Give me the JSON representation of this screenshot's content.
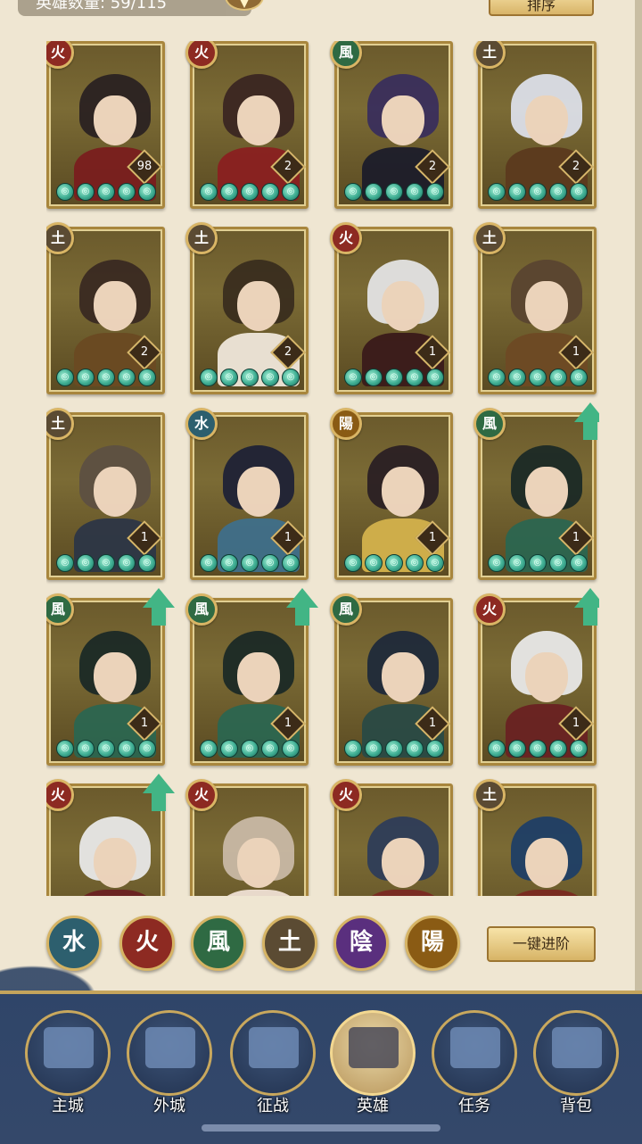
{
  "header": {
    "hero_count": "英雄数量: 59/115",
    "sort_label": "排序"
  },
  "colors": {
    "fire": "#8d2a22",
    "wind": "#2f6a43",
    "earth": "#5b4b33",
    "water": "#2d5f6e",
    "yin": "#5a2f7e",
    "yang": "#8a5b14",
    "upgrade_arrow": "#42b585"
  },
  "heroes": [
    {
      "element": "火",
      "level": "98",
      "stars": 5,
      "upgrade": false
    },
    {
      "element": "火",
      "level": "2",
      "stars": 5,
      "upgrade": false
    },
    {
      "element": "風",
      "level": "2",
      "stars": 5,
      "upgrade": false
    },
    {
      "element": "土",
      "level": "2",
      "stars": 5,
      "upgrade": false
    },
    {
      "element": "土",
      "level": "2",
      "stars": 5,
      "upgrade": false
    },
    {
      "element": "土",
      "level": "2",
      "stars": 5,
      "upgrade": false
    },
    {
      "element": "火",
      "level": "1",
      "stars": 5,
      "upgrade": false
    },
    {
      "element": "土",
      "level": "1",
      "stars": 5,
      "upgrade": false
    },
    {
      "element": "土",
      "level": "1",
      "stars": 5,
      "upgrade": false
    },
    {
      "element": "水",
      "level": "1",
      "stars": 5,
      "upgrade": false
    },
    {
      "element": "陽",
      "level": "1",
      "stars": 5,
      "upgrade": false
    },
    {
      "element": "風",
      "level": "1",
      "stars": 5,
      "upgrade": true
    },
    {
      "element": "風",
      "level": "1",
      "stars": 5,
      "upgrade": true
    },
    {
      "element": "風",
      "level": "1",
      "stars": 5,
      "upgrade": true
    },
    {
      "element": "風",
      "level": "1",
      "stars": 5,
      "upgrade": false
    },
    {
      "element": "火",
      "level": "1",
      "stars": 5,
      "upgrade": true
    },
    {
      "element": "火",
      "level": "",
      "stars": 0,
      "upgrade": true
    },
    {
      "element": "火",
      "level": "",
      "stars": 0,
      "upgrade": false
    },
    {
      "element": "火",
      "level": "",
      "stars": 0,
      "upgrade": false
    },
    {
      "element": "土",
      "level": "",
      "stars": 0,
      "upgrade": false
    }
  ],
  "filters": [
    {
      "label": "水",
      "color": "#2d5f6e"
    },
    {
      "label": "火",
      "color": "#8d2a22"
    },
    {
      "label": "風",
      "color": "#2f6a43"
    },
    {
      "label": "土",
      "color": "#5b4b33"
    },
    {
      "label": "陰",
      "color": "#5a2f7e"
    },
    {
      "label": "陽",
      "color": "#8a5b14"
    }
  ],
  "advance_button": "一键进阶",
  "nav": [
    {
      "label": "主城",
      "icon": "main-city-icon"
    },
    {
      "label": "外城",
      "icon": "outer-city-icon"
    },
    {
      "label": "征战",
      "icon": "campaign-icon"
    },
    {
      "label": "英雄",
      "icon": "hero-icon",
      "active": true
    },
    {
      "label": "任务",
      "icon": "quest-icon"
    },
    {
      "label": "背包",
      "icon": "bag-icon"
    }
  ]
}
